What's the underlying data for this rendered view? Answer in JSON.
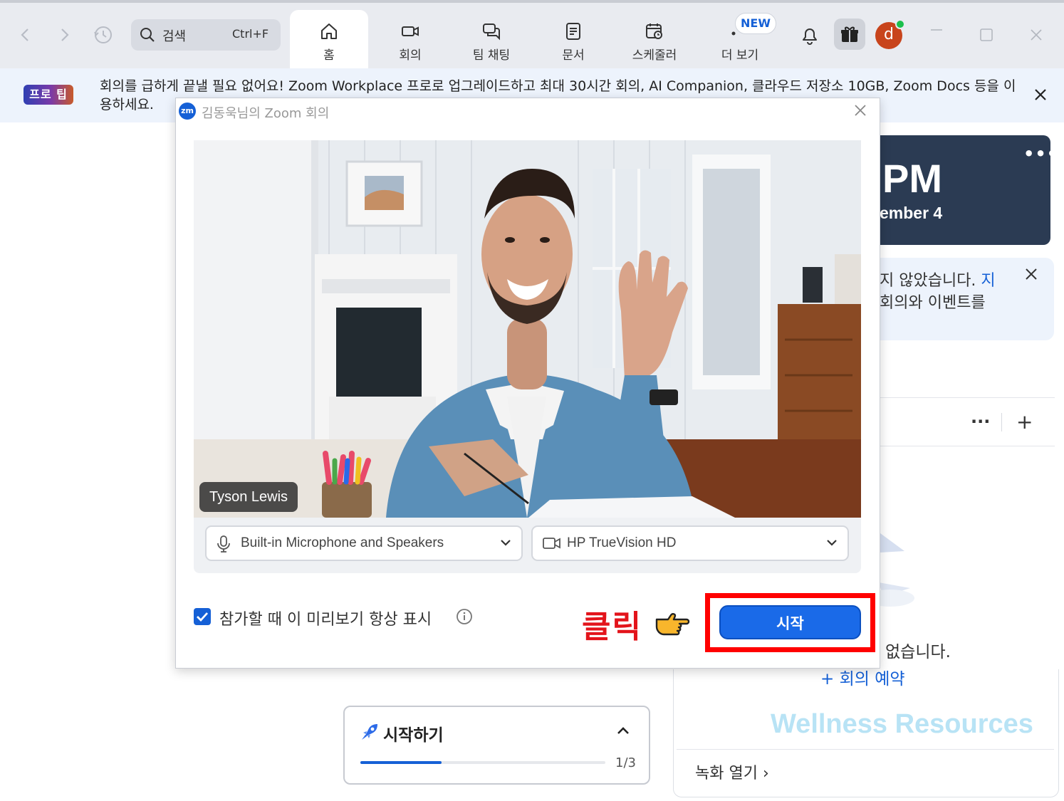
{
  "nav": {
    "search_placeholder": "검색",
    "search_shortcut": "Ctrl+F",
    "tabs": [
      {
        "label": "홈",
        "icon": "home-icon"
      },
      {
        "label": "회의",
        "icon": "video-camera-icon"
      },
      {
        "label": "팀 채팅",
        "icon": "chat-icon"
      },
      {
        "label": "문서",
        "icon": "document-icon"
      },
      {
        "label": "스케줄러",
        "icon": "scheduler-icon"
      },
      {
        "label": "더 보기",
        "icon": "more-icon"
      }
    ],
    "new_badge": "NEW",
    "avatar_initial": "d"
  },
  "banner": {
    "badge": "프로 팁",
    "text": "회의를 급하게 끝낼 필요 없어요! Zoom Workplace 프로로 업그레이드하고 최대 30시간 회의, AI Companion, 클라우드 저장소 10GB, Zoom Docs 등을 이용하세요."
  },
  "right_panel": {
    "time": "PM",
    "date": "ember 4",
    "info_line1": "지 않았습니다. ",
    "info_link": "지",
    "info_line2": "회의와 이벤트를",
    "empty_text": "없습니다.",
    "schedule_link": "+ 회의 예약",
    "watermark": "Wellness Resources",
    "recording_link": "녹화 열기 ›"
  },
  "getting_started": {
    "title": "시작하기",
    "progress_label": "1/3",
    "progress_fraction": 0.33
  },
  "dialog": {
    "logo": "zm",
    "title": "김동욱님의 Zoom 회의",
    "participant_name": "Tyson Lewis",
    "audio_device": "Built-in Microphone and Speakers",
    "video_device": "HP TrueVision HD",
    "always_show_preview_label": "참가할 때 이 미리보기 항상 표시",
    "always_show_preview_checked": true,
    "start_button": "시작"
  },
  "annotation": {
    "click_label": "클릭"
  },
  "colors": {
    "accent": "#1560d6",
    "annotation_red": "#ff0000"
  }
}
